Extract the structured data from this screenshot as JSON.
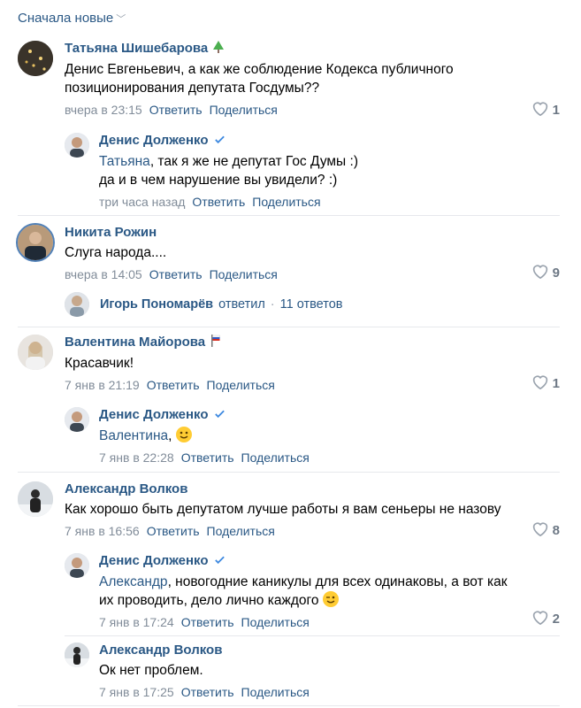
{
  "sort": {
    "label": "Сначала новые"
  },
  "actions": {
    "reply": "Ответить",
    "share": "Поделиться"
  },
  "comments": [
    {
      "author": "Татьяна Шишебарова",
      "badge_icon": "christmas-tree-icon",
      "text": "Денис Евгеньевич, а как же соблюдение Кодекса публичного позиционирования депутата Госдумы??",
      "time": "вчера в 23:15",
      "likes": "1"
    },
    {
      "author": "Денис Долженко",
      "badge_icon": "verified-check-icon",
      "mention": "Татьяна",
      "text": ", так я же не депутат Гос Думы :)",
      "text2": "да и в чем нарушение вы увидели? :)",
      "time": "три часа назад"
    },
    {
      "author": "Никита Рожин",
      "text": "Слуга народа....",
      "time": "вчера в 14:05",
      "likes": "9"
    },
    {
      "author": "Валентина Майорова",
      "badge_icon": "flag-icon",
      "text": "Красавчик!",
      "time": "7 янв в 21:19",
      "likes": "1"
    },
    {
      "author": "Денис Долженко",
      "badge_icon": "verified-check-icon",
      "mention": "Валентина",
      "text": ", ",
      "emoji": "smile-emoji",
      "time": "7 янв в 22:28"
    },
    {
      "author": "Александр Волков",
      "text": "Как хорошо быть депутатом лучше работы я вам сеньеры не назову",
      "time": "7 янв в 16:56",
      "likes": "8"
    },
    {
      "author": "Денис Долженко",
      "badge_icon": "verified-check-icon",
      "mention": "Александр",
      "text": ", новогодние каникулы для всех одинаковы, а вот как их проводить, дело лично каждого",
      "emoji": "wink-emoji",
      "time": "7 янв в 17:24",
      "likes": "2"
    },
    {
      "author": "Александр Волков",
      "text": "Ок нет проблем.",
      "time": "7 янв в 17:25"
    }
  ],
  "thread": {
    "author": "Игорь Пономарёв",
    "replied": "ответил",
    "count": "11 ответов"
  },
  "colors": {
    "link": "#2a5885",
    "meta": "#818c99",
    "verified": "#3f8ae0"
  }
}
